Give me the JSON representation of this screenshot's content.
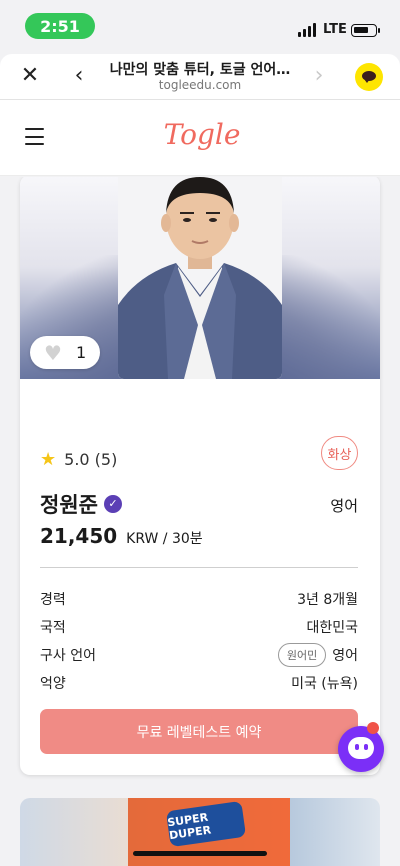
{
  "status_bar": {
    "time": "2:51",
    "network": "LTE"
  },
  "browser": {
    "page_title": "나만의 맞춤 튜터, 토글 언어…",
    "url": "togleedu.com"
  },
  "header": {
    "logo": "Togle"
  },
  "tutor_card": {
    "like_count": "1",
    "rating": "5.0 (5)",
    "lesson_type_badge": "화상",
    "name": "정원준",
    "subject": "영어",
    "price": "21,450",
    "price_unit": "KRW / 30분",
    "details": [
      {
        "label": "경력",
        "value": "3년 8개월"
      },
      {
        "label": "국적",
        "value": "대한민국"
      },
      {
        "label": "구사 언어",
        "tag": "원어민",
        "value": "영어"
      },
      {
        "label": "억양",
        "value": "미국 (뉴욕)"
      }
    ],
    "cta_label": "무료 레벨테스트 예약"
  },
  "next_card": {
    "sign_text": "SUPER DUPER"
  },
  "colors": {
    "brand": "#f06a5f",
    "cta": "#f08b85",
    "chat_fab": "#7b2ff7",
    "status_time": "#34c759"
  }
}
